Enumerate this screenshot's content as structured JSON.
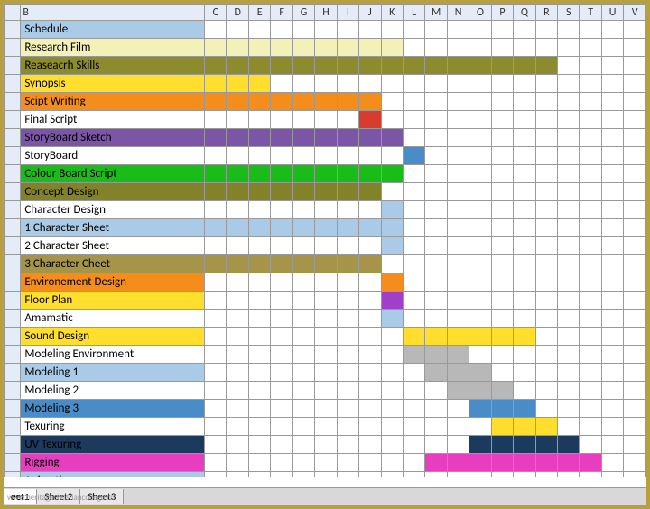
{
  "columns": [
    "",
    "B",
    "C",
    "D",
    "E",
    "F",
    "G",
    "H",
    "I",
    "J",
    "K",
    "L",
    "M",
    "N",
    "O",
    "P",
    "Q",
    "R",
    "S",
    "T",
    "U",
    "V"
  ],
  "colors": {
    "lightblue": "#a9cbe8",
    "blue": "#4a8cc7",
    "darkblue": "#1f4e79",
    "yellow": "#ffde2e",
    "paleyellow": "#f3f0b8",
    "olive": "#8c8c2e",
    "orange": "#f58d1c",
    "red": "#d93c2e",
    "purple": "#7b56a6",
    "brightpurple": "#a040c8",
    "green": "#1abc1a",
    "darkolive": "#828228",
    "tan": "#a69549",
    "gray": "#b8b8b8",
    "magenta": "#e63ebf",
    "navy": "#1c3a5e",
    "white": "#ffffff"
  },
  "rows": [
    {
      "label": "Schedule",
      "labelBg": "lightblue",
      "cells": {}
    },
    {
      "label": "Research Film",
      "labelBg": "paleyellow",
      "cells": {
        "C": "paleyellow",
        "D": "paleyellow",
        "E": "paleyellow",
        "F": "paleyellow",
        "G": "paleyellow",
        "H": "paleyellow",
        "I": "paleyellow",
        "J": "paleyellow",
        "K": "paleyellow"
      }
    },
    {
      "label": "Reaseacrh Skills",
      "labelBg": "olive",
      "cells": {
        "C": "olive",
        "D": "olive",
        "E": "olive",
        "F": "olive",
        "G": "olive",
        "H": "olive",
        "I": "olive",
        "J": "olive",
        "K": "olive",
        "L": "olive",
        "M": "olive",
        "N": "olive",
        "O": "olive",
        "P": "olive",
        "Q": "olive",
        "R": "olive"
      }
    },
    {
      "label": "Synopsis",
      "labelBg": "yellow",
      "cells": {
        "C": "yellow",
        "D": "yellow",
        "E": "yellow"
      }
    },
    {
      "label": "Scipt Writing",
      "labelBg": "orange",
      "cells": {
        "C": "orange",
        "D": "orange",
        "E": "orange",
        "F": "orange",
        "G": "orange",
        "H": "orange",
        "I": "orange",
        "J": "orange"
      }
    },
    {
      "label": "Final Script",
      "labelBg": "white",
      "cells": {
        "J": "red"
      }
    },
    {
      "label": "StoryBoard Sketch",
      "labelBg": "purple",
      "cells": {
        "C": "purple",
        "D": "purple",
        "E": "purple",
        "F": "purple",
        "G": "purple",
        "H": "purple",
        "I": "purple",
        "J": "purple",
        "K": "purple"
      }
    },
    {
      "label": "StoryBoard",
      "labelBg": "white",
      "cells": {
        "L": "blue"
      }
    },
    {
      "label": "Colour Board Script",
      "labelBg": "green",
      "cells": {
        "C": "green",
        "D": "green",
        "E": "green",
        "F": "green",
        "G": "green",
        "H": "green",
        "I": "green",
        "J": "green",
        "K": "green"
      }
    },
    {
      "label": "Concept Design",
      "labelBg": "darkolive",
      "cells": {
        "C": "darkolive",
        "D": "darkolive",
        "E": "darkolive",
        "F": "darkolive",
        "G": "darkolive",
        "H": "darkolive",
        "I": "darkolive",
        "J": "darkolive"
      }
    },
    {
      "label": "Character Design",
      "labelBg": "white",
      "cells": {
        "K": "lightblue"
      }
    },
    {
      "label": "1 Character Sheet",
      "labelBg": "lightblue",
      "cells": {
        "C": "lightblue",
        "D": "lightblue",
        "E": "lightblue",
        "F": "lightblue",
        "G": "lightblue",
        "H": "lightblue",
        "I": "lightblue",
        "J": "lightblue",
        "K": "lightblue"
      }
    },
    {
      "label": "2 Character Sheet",
      "labelBg": "white",
      "cells": {
        "K": "lightblue"
      }
    },
    {
      "label": "3 Character Cheet",
      "labelBg": "tan",
      "cells": {
        "C": "tan",
        "D": "tan",
        "E": "tan",
        "F": "tan",
        "G": "tan",
        "H": "tan",
        "I": "tan",
        "J": "tan"
      }
    },
    {
      "label": "Environement Design",
      "labelBg": "orange",
      "cells": {
        "K": "orange"
      }
    },
    {
      "label": "Floor Plan",
      "labelBg": "yellow",
      "cells": {
        "K": "brightpurple"
      }
    },
    {
      "label": "Amamatic",
      "labelBg": "white",
      "cells": {
        "K": "lightblue"
      }
    },
    {
      "label": "Sound Design",
      "labelBg": "yellow",
      "cells": {
        "L": "yellow",
        "M": "yellow",
        "N": "yellow",
        "O": "yellow",
        "P": "yellow",
        "Q": "yellow"
      }
    },
    {
      "label": "Modeling Environment",
      "labelBg": "white",
      "cells": {
        "L": "gray",
        "M": "gray",
        "N": "gray"
      }
    },
    {
      "label": "Modeling 1",
      "labelBg": "lightblue",
      "cells": {
        "M": "gray",
        "N": "gray",
        "O": "gray"
      }
    },
    {
      "label": "Modeling 2",
      "labelBg": "white",
      "cells": {
        "N": "gray",
        "O": "gray",
        "P": "gray"
      }
    },
    {
      "label": "Modeling 3",
      "labelBg": "blue",
      "cells": {
        "O": "blue",
        "P": "blue",
        "Q": "blue"
      }
    },
    {
      "label": "Texuring",
      "labelBg": "white",
      "cells": {
        "P": "yellow",
        "Q": "yellow",
        "R": "yellow"
      }
    },
    {
      "label": "UV Texuring",
      "labelBg": "navy",
      "cells": {
        "O": "navy",
        "P": "navy",
        "Q": "navy",
        "R": "navy",
        "S": "navy"
      }
    },
    {
      "label": "Rigging",
      "labelBg": "magenta",
      "cells": {
        "M": "magenta",
        "N": "magenta",
        "O": "magenta",
        "P": "magenta",
        "Q": "magenta",
        "R": "magenta",
        "S": "magenta",
        "T": "magenta"
      }
    },
    {
      "label": "Animation",
      "labelBg": "lightblue",
      "cells": {}
    }
  ],
  "tabs": [
    "eet1",
    "Sheet2",
    "Sheet3"
  ],
  "activeTab": 0,
  "watermark": "www.heritagechristiancollege.co"
}
